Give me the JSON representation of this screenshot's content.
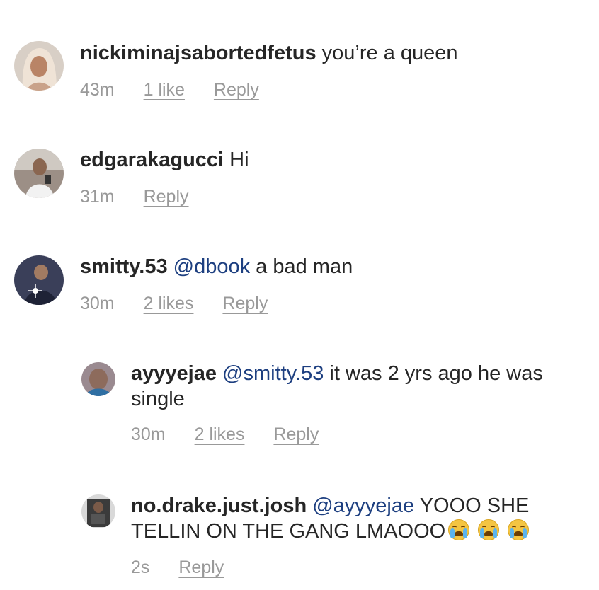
{
  "comments": [
    {
      "username": "nickiminajsabortedfetus",
      "mention": "",
      "text": "you’re a queen",
      "time": "43m",
      "likes": "1 like",
      "reply": "Reply",
      "avatar_icon": "profile-photo-icon"
    },
    {
      "username": "edgarakagucci",
      "mention": "",
      "text": "Hi",
      "time": "31m",
      "likes": "",
      "reply": "Reply",
      "avatar_icon": "profile-photo-icon"
    },
    {
      "username": "smitty.53",
      "mention": "@dbook",
      "text": "a bad man",
      "time": "30m",
      "likes": "2 likes",
      "reply": "Reply",
      "avatar_icon": "profile-photo-icon"
    },
    {
      "username": "ayyyejae",
      "mention": "@smitty.53",
      "text": "it was 2 yrs ago he was single",
      "time": "30m",
      "likes": "2 likes",
      "reply": "Reply",
      "avatar_icon": "profile-photo-icon"
    },
    {
      "username": "no.drake.just.josh",
      "mention": "@ayyyejae",
      "text": "YOOO SHE TELLIN ON THE GANG LMAOOO",
      "emoji": "loudly-crying-face-icon",
      "emoji_count": 3,
      "time": "2s",
      "likes": "",
      "reply": "Reply",
      "avatar_icon": "profile-photo-icon"
    }
  ],
  "colors": {
    "text": "#262626",
    "meta": "#999999",
    "mention": "#1d3f80"
  }
}
